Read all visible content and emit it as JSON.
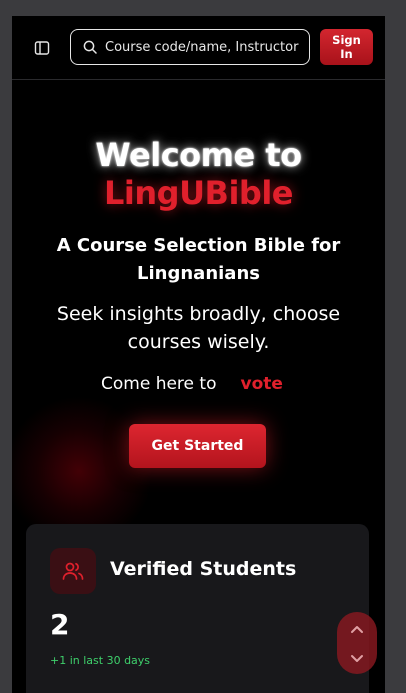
{
  "header": {
    "search_placeholder": "Course code/name, Instructor",
    "signin_label": "Sign In"
  },
  "hero": {
    "title_line1": "Welcome to",
    "title_line2": "LingUBible",
    "subtitle": "A Course Selection Bible for Lingnanians",
    "tagline": "Seek insights broadly, choose courses wisely.",
    "vote_prefix": "Come here to",
    "vote_word": "vote",
    "cta_label": "Get Started"
  },
  "stats": {
    "title": "Verified Students",
    "value": "2",
    "delta": "+1 in last 30 days",
    "icon": "users-icon"
  },
  "colors": {
    "brand_red": "#e0202c",
    "button_red": "#c81c25",
    "positive_green": "#3ecf6b",
    "card_bg": "#18181b",
    "page_bg": "#000000"
  },
  "icons": [
    "sidebar-toggle-icon",
    "search-icon",
    "users-icon",
    "chevron-up-icon",
    "chevron-down-icon"
  ]
}
